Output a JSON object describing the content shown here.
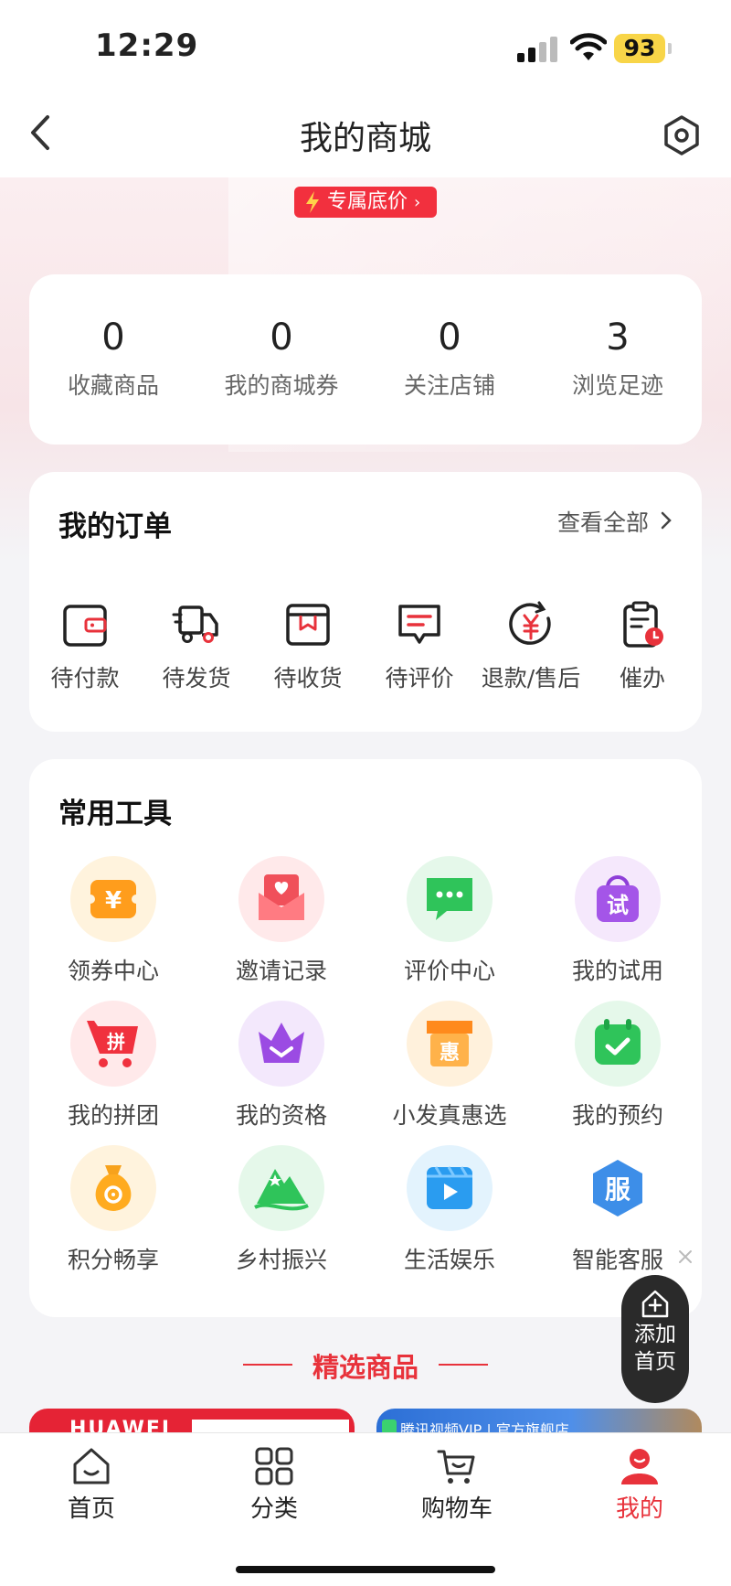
{
  "status_bar": {
    "time": "12:29",
    "battery": "93"
  },
  "nav": {
    "title": "我的商城",
    "back_icon": "chevron-left-icon",
    "settings_icon": "hexagon-settings-icon"
  },
  "promo": {
    "label": "专属底价"
  },
  "stats": [
    {
      "value": "0",
      "label": "收藏商品"
    },
    {
      "value": "0",
      "label": "我的商城券"
    },
    {
      "value": "0",
      "label": "关注店铺"
    },
    {
      "value": "3",
      "label": "浏览足迹"
    }
  ],
  "orders": {
    "title": "我的订单",
    "view_all": "查看全部",
    "items": [
      {
        "label": "待付款",
        "icon": "wallet-icon"
      },
      {
        "label": "待发货",
        "icon": "truck-icon"
      },
      {
        "label": "待收货",
        "icon": "box-icon"
      },
      {
        "label": "待评价",
        "icon": "comment-icon"
      },
      {
        "label": "退款/售后",
        "icon": "refund-icon"
      },
      {
        "label": "催办",
        "icon": "clipboard-clock-icon"
      }
    ]
  },
  "tools": {
    "title": "常用工具",
    "items": [
      {
        "label": "领券中心",
        "icon": "coupon-icon"
      },
      {
        "label": "邀请记录",
        "icon": "invite-letter-icon"
      },
      {
        "label": "评价中心",
        "icon": "chat-bubble-icon"
      },
      {
        "label": "我的试用",
        "icon": "trial-bag-icon",
        "glyph": "试"
      },
      {
        "label": "我的拼团",
        "icon": "group-cart-icon",
        "glyph": "拼"
      },
      {
        "label": "我的资格",
        "icon": "crown-icon"
      },
      {
        "label": "小发真惠选",
        "icon": "store-icon",
        "glyph": "惠"
      },
      {
        "label": "我的预约",
        "icon": "calendar-check-icon"
      },
      {
        "label": "积分畅享",
        "icon": "money-bag-icon"
      },
      {
        "label": "乡村振兴",
        "icon": "mountain-icon"
      },
      {
        "label": "生活娱乐",
        "icon": "video-play-icon"
      },
      {
        "label": "智能客服",
        "icon": "service-hexagon-icon",
        "glyph": "服"
      }
    ]
  },
  "featured": {
    "title": "精选商品"
  },
  "products": [
    {
      "brand": "HUAWEI"
    },
    {
      "text": "腾讯视频VIP | 官方旗舰店"
    }
  ],
  "floating": {
    "line1": "添加",
    "line2": "首页"
  },
  "tabbar": [
    {
      "label": "首页",
      "icon": "home-icon"
    },
    {
      "label": "分类",
      "icon": "category-grid-icon"
    },
    {
      "label": "购物车",
      "icon": "cart-icon"
    },
    {
      "label": "我的",
      "icon": "user-icon",
      "active": true
    }
  ],
  "colors": {
    "accent": "#e8323b",
    "promo": "#f2303e",
    "background": "#f4f4f7"
  }
}
